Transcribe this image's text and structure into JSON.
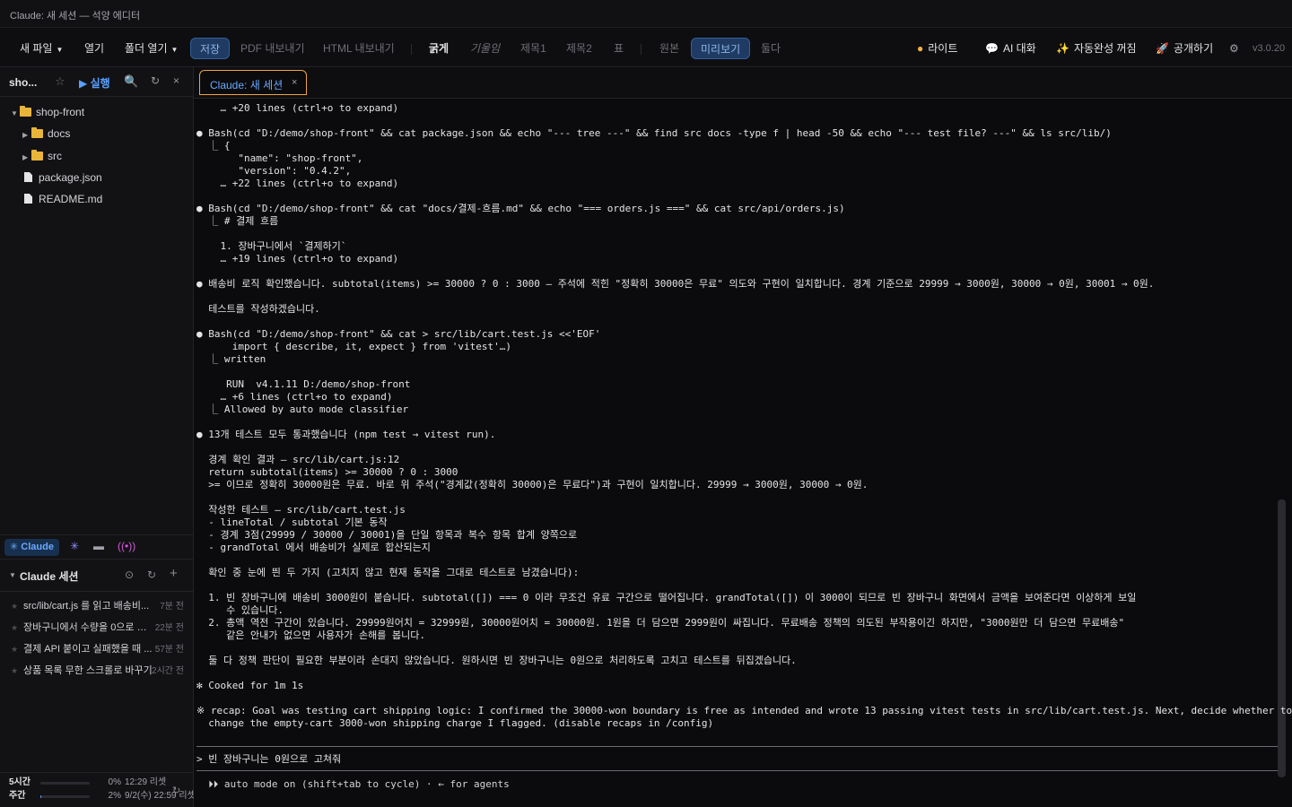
{
  "window": {
    "title": "Claude: 새 세션 — 석양 에디터"
  },
  "menubar": {
    "new_file": "새 파일",
    "open": "열기",
    "open_folder": "폴더 열기",
    "save": "저장",
    "export_pdf": "PDF 내보내기",
    "export_html": "HTML 내보내기",
    "bold": "굵게",
    "italic": "기울임",
    "h1": "제목1",
    "h2": "제목2",
    "table": "표",
    "source": "원본",
    "preview": "미리보기",
    "both": "둘다",
    "theme": "라이트",
    "ai_chat": "AI 대화",
    "autocomplete": "자동완성 꺼짐",
    "publish": "공개하기",
    "version": "v3.0.20"
  },
  "sidebar": {
    "project": "sho...",
    "run": "▶ 실행",
    "tree": [
      {
        "label": "shop-front",
        "kind": "folder",
        "open": true
      },
      {
        "label": "docs",
        "kind": "folder",
        "open": false
      },
      {
        "label": "src",
        "kind": "folder",
        "open": false
      },
      {
        "label": "package.json",
        "kind": "file"
      },
      {
        "label": "README.md",
        "kind": "file"
      }
    ],
    "tabs": {
      "claude": "✳ Claude"
    },
    "sessions_title": "Claude 세션",
    "sessions": [
      {
        "text": "src/lib/cart.js 를 읽고 배송비...",
        "time": "7분 전"
      },
      {
        "text": "장바구니에서 수량을 0으로 바...",
        "time": "22분 전"
      },
      {
        "text": "결제 API 붙이고 실패했을 때 ...",
        "time": "57분 전"
      },
      {
        "text": "상품 목록 무한 스크롤로 바꾸기",
        "time": "2시간 전"
      }
    ],
    "usage": [
      {
        "label": "5시간",
        "percent": 0,
        "percent_text": "0%",
        "reset": "12:29 리셋"
      },
      {
        "label": "주간",
        "percent": 2,
        "percent_text": "2%",
        "reset": "9/2(수) 22:59 리셋"
      }
    ]
  },
  "editor_tab": {
    "title": "Claude: 새 세션",
    "close": "×"
  },
  "terminal": {
    "lines": [
      "    … +20 lines (ctrl+o to expand)",
      "",
      "● Bash(cd \"D:/demo/shop-front\" && cat package.json && echo \"--- tree ---\" && find src docs -type f | head -50 && echo \"--- test file? ---\" && ls src/lib/)",
      "  ⎿ {",
      "       \"name\": \"shop-front\",",
      "       \"version\": \"0.4.2\",",
      "    … +22 lines (ctrl+o to expand)",
      "",
      "● Bash(cd \"D:/demo/shop-front\" && cat \"docs/결제-흐름.md\" && echo \"=== orders.js ===\" && cat src/api/orders.js)",
      "  ⎿ # 결제 흐름",
      "",
      "    1. 장바구니에서 `결제하기`",
      "    … +19 lines (ctrl+o to expand)",
      "",
      "● 배송비 로직 확인했습니다. subtotal(items) >= 30000 ? 0 : 3000 — 주석에 적힌 \"정확히 30000은 무료\" 의도와 구현이 일치합니다. 경계 기준으로 29999 → 3000원, 30000 → 0원, 30001 → 0원.",
      "",
      "  테스트를 작성하겠습니다.",
      "",
      "● Bash(cd \"D:/demo/shop-front\" && cat > src/lib/cart.test.js <<'EOF'",
      "      import { describe, it, expect } from 'vitest'…)",
      "  ⎿ written",
      "",
      "     RUN  v4.1.11 D:/demo/shop-front",
      "    … +6 lines (ctrl+o to expand)",
      "  ⎿ Allowed by auto mode classifier",
      "",
      "● 13개 테스트 모두 통과했습니다 (npm test → vitest run).",
      "",
      "  경계 확인 결과 — src/lib/cart.js:12",
      "  return subtotal(items) >= 30000 ? 0 : 3000",
      "  >= 이므로 정확히 30000원은 무료. 바로 위 주석(\"경계값(정확히 30000)은 무료다\")과 구현이 일치합니다. 29999 → 3000원, 30000 → 0원.",
      "",
      "  작성한 테스트 — src/lib/cart.test.js",
      "  - lineTotal / subtotal 기본 동작",
      "  - 경계 3점(29999 / 30000 / 30001)을 단일 항목과 복수 항목 합계 양쪽으로",
      "  - grandTotal 에서 배송비가 실제로 합산되는지",
      "",
      "  확인 중 눈에 띈 두 가지 (고치지 않고 현재 동작을 그대로 테스트로 남겼습니다):",
      "",
      "  1. 빈 장바구니에 배송비 3000원이 붙습니다. subtotal([]) === 0 이라 무조건 유료 구간으로 떨어집니다. grandTotal([]) 이 3000이 되므로 빈 장바구니 화면에서 금액을 보여준다면 이상하게 보일",
      "     수 있습니다.",
      "  2. 총액 역전 구간이 있습니다. 29999원어치 = 32999원, 30000원어치 = 30000원. 1원을 더 담으면 2999원이 싸집니다. 무료배송 정책의 의도된 부작용이긴 하지만, \"3000원만 더 담으면 무료배송\"",
      "     같은 안내가 없으면 사용자가 손해를 봅니다.",
      "",
      "  둘 다 정책 판단이 필요한 부분이라 손대지 않았습니다. 원하시면 빈 장바구니는 0원으로 처리하도록 고치고 테스트를 뒤집겠습니다.",
      "",
      "✻ Cooked for 1m 1s",
      "",
      "※ recap: Goal was testing cart shipping logic: I confirmed the 30000-won boundary is free as intended and wrote 13 passing vitest tests in src/lib/cart.test.js. Next, decide whether to",
      "  change the empty-cart 3000-won shipping charge I flagged. (disable recaps in /config)"
    ],
    "prompt": "> 빈 장바구니는 0원으로 고쳐줘",
    "status": "  ⏵⏵ auto mode on (shift+tab to cycle) · ← for agents"
  }
}
